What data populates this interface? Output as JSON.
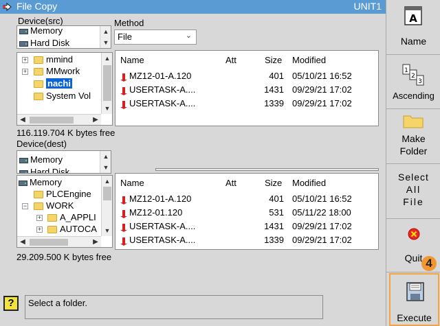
{
  "window": {
    "title": "File Copy",
    "unit": "UNIT1"
  },
  "src": {
    "device_label": "Device(src)",
    "method_label": "Method",
    "method_value": "File",
    "drives": [
      "Memory",
      "Hard Disk"
    ],
    "tree": [
      "mmind",
      "MMwork",
      "nachi",
      "System Vol"
    ],
    "free": "116.119.704 K bytes free",
    "columns": {
      "name": "Name",
      "att": "Att",
      "size": "Size",
      "modified": "Modified"
    },
    "files": [
      {
        "name": "MZ12-01-A.120",
        "size": "401",
        "modified": "05/10/21 16:52"
      },
      {
        "name": "USERTASK-A....",
        "size": "1431",
        "modified": "09/29/21 17:02"
      },
      {
        "name": "USERTASK-A....",
        "size": "1339",
        "modified": "09/29/21 17:02"
      }
    ]
  },
  "dest": {
    "device_label": "Device(dest)",
    "drives": [
      "Memory",
      "Hard Disk"
    ],
    "tree": [
      "Memory",
      "PLCEngine",
      "WORK",
      "A_APPLI",
      "AUTOCA"
    ],
    "free": "29.209.500 K bytes free",
    "columns": {
      "name": "Name",
      "att": "Att",
      "size": "Size",
      "modified": "Modified"
    },
    "files": [
      {
        "name": "MZ12-01-A.120",
        "size": "401",
        "modified": "05/10/21 16:52"
      },
      {
        "name": "MZ12-01.120",
        "size": "531",
        "modified": "05/11/22 18:00"
      },
      {
        "name": "USERTASK-A....",
        "size": "1431",
        "modified": "09/29/21 17:02"
      },
      {
        "name": "USERTASK-A....",
        "size": "1339",
        "modified": "09/29/21 17:02"
      }
    ]
  },
  "status_text": "Select a folder.",
  "sidebar": {
    "name": "Name",
    "ascending": "Ascending",
    "make_folder_1": "Make",
    "make_folder_2": "Folder",
    "select_all_1": "Select",
    "select_all_2": "All",
    "select_all_3": "File",
    "quit": "Quit",
    "execute": "Execute"
  },
  "badge": "4"
}
